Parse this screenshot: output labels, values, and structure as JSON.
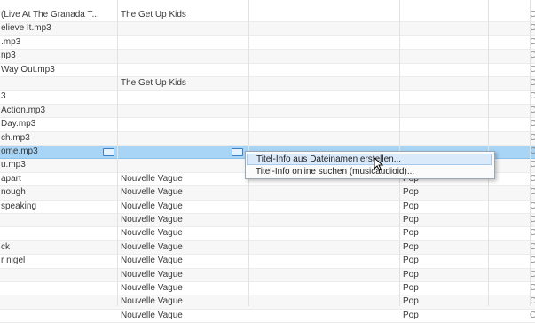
{
  "rows": [
    {
      "file": "(Live At The Granada T...",
      "artist": "The Get Up Kids",
      "genre": "",
      "last": "C"
    },
    {
      "file": "elieve It.mp3",
      "artist": "",
      "genre": "",
      "last": "C"
    },
    {
      "file": ".mp3",
      "artist": "",
      "genre": "",
      "last": "C"
    },
    {
      "file": "np3",
      "artist": "",
      "genre": "",
      "last": "C"
    },
    {
      "file": "Way Out.mp3",
      "artist": "",
      "genre": "",
      "last": "C"
    },
    {
      "file": "",
      "artist": "The Get Up Kids",
      "genre": "",
      "last": "C"
    },
    {
      "file": "3",
      "artist": "",
      "genre": "",
      "last": "C"
    },
    {
      "file": "Action.mp3",
      "artist": "",
      "genre": "",
      "last": "C"
    },
    {
      "file": "Day.mp3",
      "artist": "",
      "genre": "",
      "last": "C"
    },
    {
      "file": "ch.mp3",
      "artist": "",
      "genre": "",
      "last": "C"
    },
    {
      "file": "ome.mp3",
      "artist": "",
      "genre": "",
      "last": "C",
      "selected": true
    },
    {
      "file": "u.mp3",
      "artist": "",
      "genre": "",
      "last": "C"
    },
    {
      "file": "apart",
      "artist": "Nouvelle Vague",
      "genre": "Pop",
      "last": "C"
    },
    {
      "file": "nough",
      "artist": "Nouvelle Vague",
      "genre": "Pop",
      "last": "C"
    },
    {
      "file": "speaking",
      "artist": "Nouvelle Vague",
      "genre": "Pop",
      "last": "C"
    },
    {
      "file": "",
      "artist": "Nouvelle Vague",
      "genre": "Pop",
      "last": "C"
    },
    {
      "file": "",
      "artist": "Nouvelle Vague",
      "genre": "Pop",
      "last": "C"
    },
    {
      "file": "ck",
      "artist": "Nouvelle Vague",
      "genre": "Pop",
      "last": "C"
    },
    {
      "file": "r nigel",
      "artist": "Nouvelle Vague",
      "genre": "Pop",
      "last": "C"
    },
    {
      "file": "",
      "artist": "Nouvelle Vague",
      "genre": "Pop",
      "last": "C"
    },
    {
      "file": "",
      "artist": "Nouvelle Vague",
      "genre": "Pop",
      "last": "C"
    },
    {
      "file": "",
      "artist": "Nouvelle Vague",
      "genre": "Pop",
      "last": "C"
    },
    {
      "file": "",
      "artist": "Nouvelle Vague",
      "genre": "Pop",
      "last": "C"
    }
  ],
  "context_menu": {
    "items": [
      {
        "label": "Titel-Info aus Dateinamen erstellen..."
      },
      {
        "label": "Titel-Info online suchen (musicaudioid)..."
      }
    ]
  },
  "colors": {
    "selection": "#a8d4f5",
    "menu_highlight": "#dbeafb"
  }
}
